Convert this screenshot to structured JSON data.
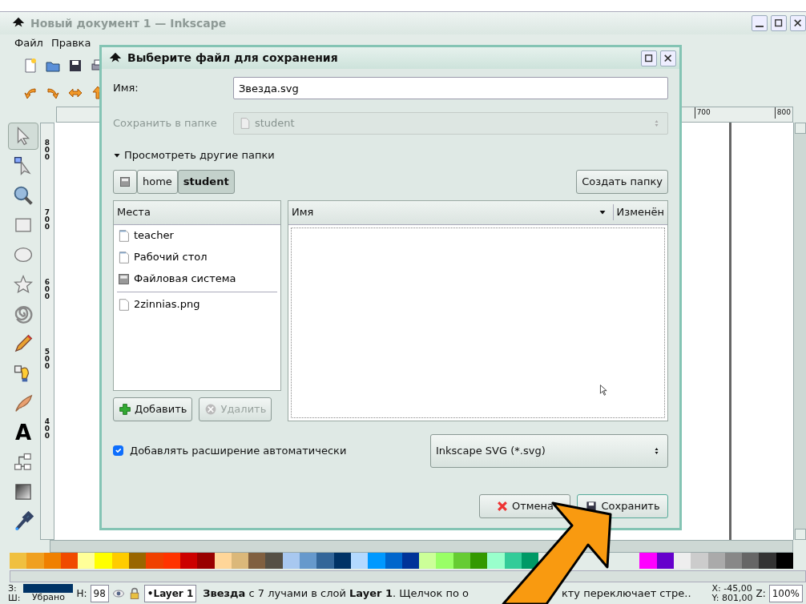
{
  "window": {
    "title": "Новый документ 1 — Inkscape",
    "active": false
  },
  "menu": [
    "Файл",
    "Правка"
  ],
  "toolbar_commands": [
    {
      "kind": "new"
    },
    {
      "kind": "open"
    },
    {
      "kind": "save"
    },
    {
      "kind": "print"
    }
  ],
  "toolbar_snaps": [
    {
      "kind": "left"
    },
    {
      "kind": "right"
    },
    {
      "kind": "both"
    },
    {
      "kind": "up"
    }
  ],
  "toolbox": [
    {
      "kind": "selector",
      "selected": true
    },
    {
      "kind": "node",
      "selected": false
    },
    {
      "kind": "zoom",
      "selected": false
    },
    {
      "kind": "rect",
      "selected": false
    },
    {
      "kind": "ellipse",
      "selected": false
    },
    {
      "kind": "star",
      "selected": false
    },
    {
      "kind": "spiral",
      "selected": false
    },
    {
      "kind": "pencil",
      "selected": false
    },
    {
      "kind": "pen",
      "selected": false
    },
    {
      "kind": "calligraphy",
      "selected": false
    },
    {
      "kind": "text",
      "glyph": "A",
      "selected": false
    },
    {
      "kind": "connector",
      "selected": false
    },
    {
      "kind": "gradient",
      "selected": false
    },
    {
      "kind": "dropper",
      "selected": false
    }
  ],
  "top_ruler": [
    "700",
    "800"
  ],
  "left_ruler": [
    "800",
    "700",
    "600",
    "500",
    "400"
  ],
  "palette_left": [
    {
      "color": "#f0c040"
    },
    {
      "color": "#f0a020"
    },
    {
      "color": "#f08000"
    },
    {
      "color": "#f04a00"
    },
    {
      "color": "#ffff99"
    },
    {
      "color": "#ffff00"
    },
    {
      "color": "#ffcc00"
    },
    {
      "color": "#996600"
    },
    {
      "color": "#f04000"
    },
    {
      "color": "#ff3300"
    },
    {
      "color": "#cc0000"
    },
    {
      "color": "#990000"
    },
    {
      "color": "#ffd699"
    },
    {
      "color": "#dbb87a"
    },
    {
      "color": "#806040"
    },
    {
      "color": "#555045"
    },
    {
      "color": "#a8c8f0"
    },
    {
      "color": "#6699cc"
    },
    {
      "color": "#336699"
    },
    {
      "color": "#003366"
    },
    {
      "color": "#b3d9ff"
    },
    {
      "color": "#0099ff"
    },
    {
      "color": "#0066cc"
    },
    {
      "color": "#003399"
    },
    {
      "color": "#ccff99"
    },
    {
      "color": "#99ff66"
    },
    {
      "color": "#66cc33"
    },
    {
      "color": "#339900"
    },
    {
      "color": "#99ffcc"
    },
    {
      "color": "#33cc99"
    },
    {
      "color": "#009966"
    }
  ],
  "palette_right": [
    {
      "color": "#ff00ff"
    },
    {
      "color": "#6600cc"
    },
    {
      "color": "#eeeeee"
    },
    {
      "color": "#cccccc"
    },
    {
      "color": "#aaaaaa"
    },
    {
      "color": "#888888"
    },
    {
      "color": "#666666"
    },
    {
      "color": "#333333"
    },
    {
      "color": "#000000"
    }
  ],
  "status_bar": {
    "fill_label": "З:",
    "stroke_label": "Ш:",
    "stroke_text": "Убрано",
    "opacity_label": "Н:",
    "opacity": "98",
    "layer": "•Layer 1",
    "message": [
      "**Звезда** с 7 лучами в слой **Layer 1**. Щелчок по о",
      "кту переключает стре.."
    ],
    "x": "X: -45,00",
    "y": "Y: 801,00",
    "zoom_label": "Z:",
    "zoom": "100%"
  },
  "dialog": {
    "title": "Выберите файл для сохранения",
    "name_label": "Имя:",
    "name_value": "Звезда.svg",
    "folder_label": "Сохранить в папке",
    "folder_value": "student",
    "folder_disabled": true,
    "expander": "Просмотреть другие папки",
    "expanded": true,
    "path": [
      {
        "kind": "drive",
        "selected": false
      },
      {
        "kind": "folder",
        "label": "home",
        "selected": false
      },
      {
        "kind": "folder",
        "label": "student",
        "selected": true
      }
    ],
    "create_folder": "Создать папку",
    "places_header": "Места",
    "places": [
      {
        "kind": "folder",
        "label": "teacher",
        "separator_before": false
      },
      {
        "kind": "folder",
        "label": "Рабочий стол",
        "separator_before": false
      },
      {
        "kind": "drive",
        "label": "Файловая система",
        "separator_before": false
      },
      {
        "kind": "file",
        "label": "2zinnias.png",
        "separator_before": true
      }
    ],
    "add_button": {
      "label": "Добавить",
      "disabled": false
    },
    "remove_button": {
      "label": "Удалить",
      "disabled": true
    },
    "files_columns": [
      "Имя",
      "Изменён"
    ],
    "auto_extension": {
      "label": "Добавлять расширение автоматически",
      "checked": true
    },
    "filter": "Inkscape SVG (*.svg)",
    "cancel": "Отмена",
    "save": "Сохранить"
  }
}
